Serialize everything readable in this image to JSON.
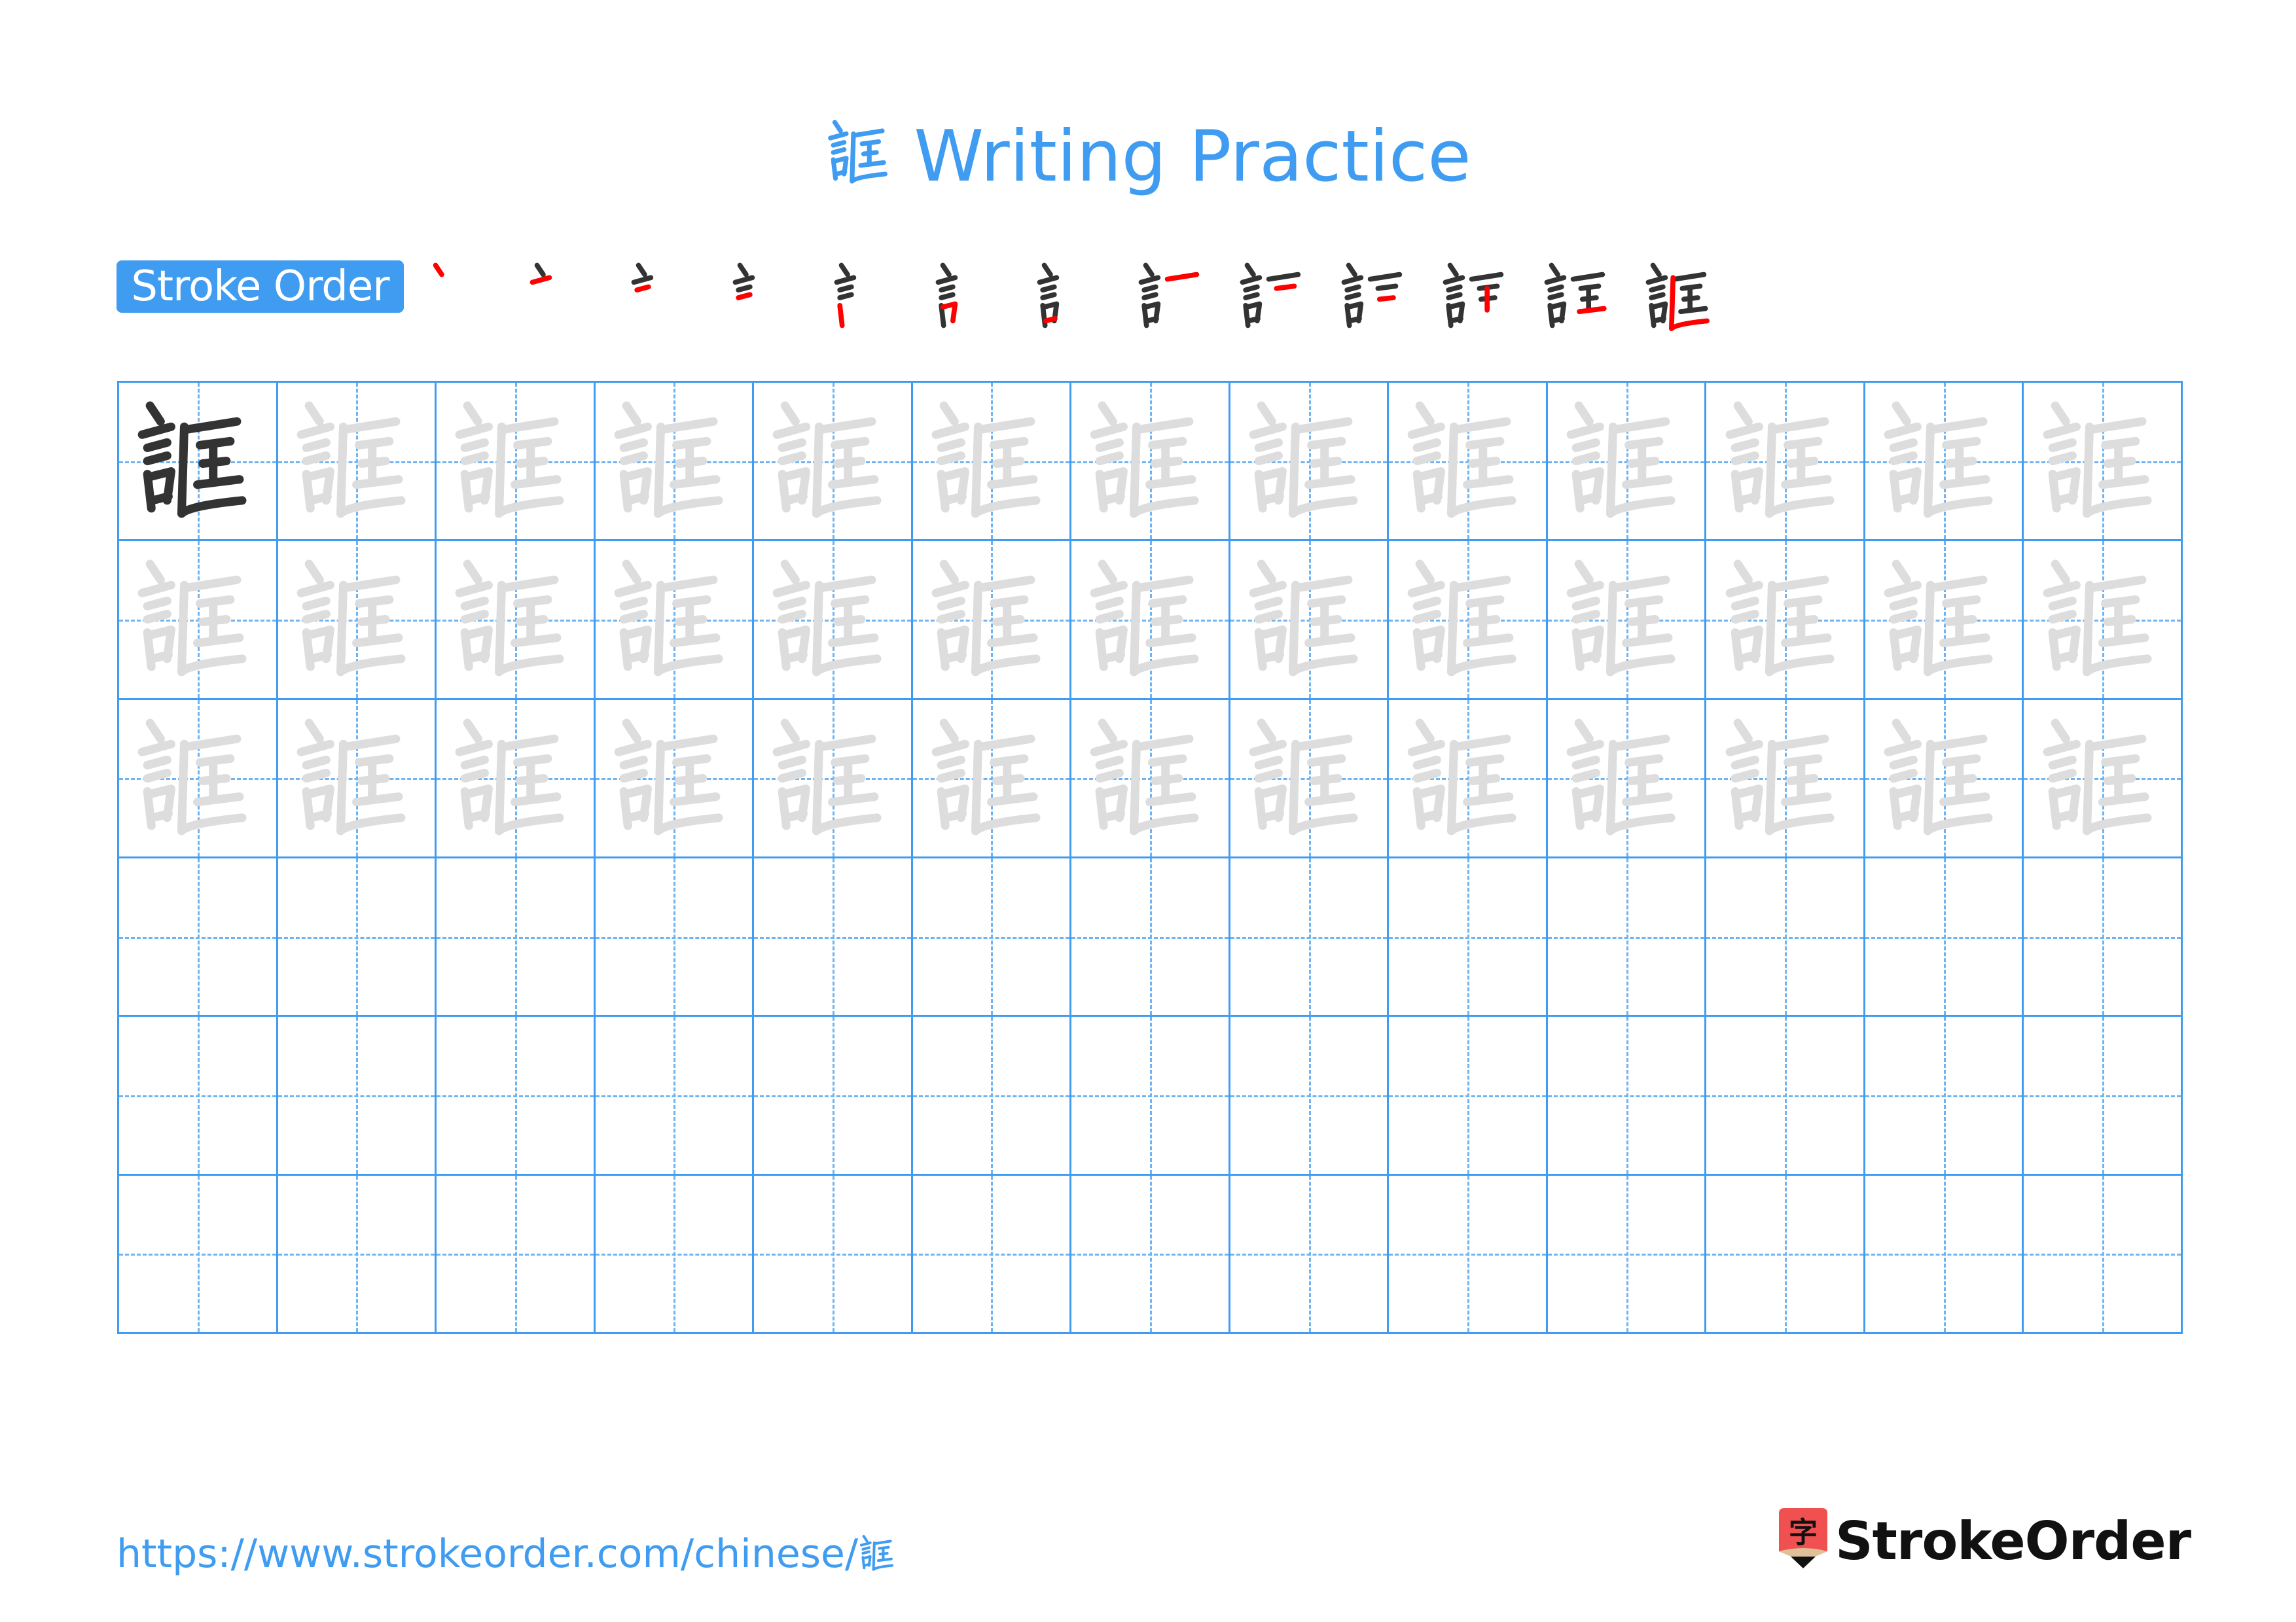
{
  "page": {
    "character": "誆",
    "title_suffix": "Writing Practice",
    "stroke_order_label": "Stroke Order",
    "stroke_count": 13,
    "footer_url": "https://www.strokeorder.com/chinese/",
    "footer_url_char": "誆",
    "brand": "StrokeOrder",
    "logo_glyph": "字"
  },
  "colors": {
    "accent": "#3f9cf0",
    "grid_dash": "#6fb4f2",
    "char_dark": "#333333",
    "char_trace": "#dddddd",
    "stroke_highlight": "#ff0000",
    "logo_red": "#f05050",
    "logo_tan": "#e0c098"
  },
  "grid": {
    "columns": 13,
    "rows": 6,
    "rows_content": [
      "model-then-trace",
      "trace",
      "trace",
      "empty",
      "empty",
      "empty"
    ]
  }
}
